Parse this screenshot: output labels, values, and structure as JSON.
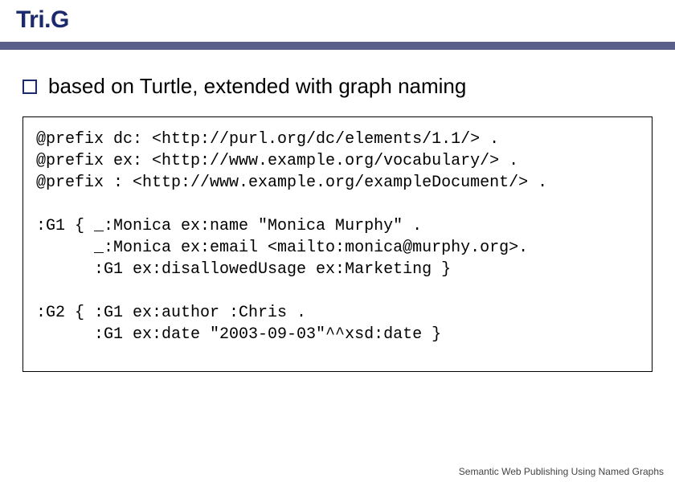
{
  "title": "Tri.G",
  "bullet": "based on Turtle, extended with graph naming",
  "code": "@prefix dc: <http://purl.org/dc/elements/1.1/> .\n@prefix ex: <http://www.example.org/vocabulary/> .\n@prefix : <http://www.example.org/exampleDocument/> .\n\n:G1 { _:Monica ex:name \"Monica Murphy\" .\n      _:Monica ex:email <mailto:monica@murphy.org>.\n      :G1 ex:disallowedUsage ex:Marketing }\n\n:G2 { :G1 ex:author :Chris .\n      :G1 ex:date \"2003-09-03\"^^xsd:date }",
  "footer": "Semantic Web Publishing Using Named Graphs"
}
